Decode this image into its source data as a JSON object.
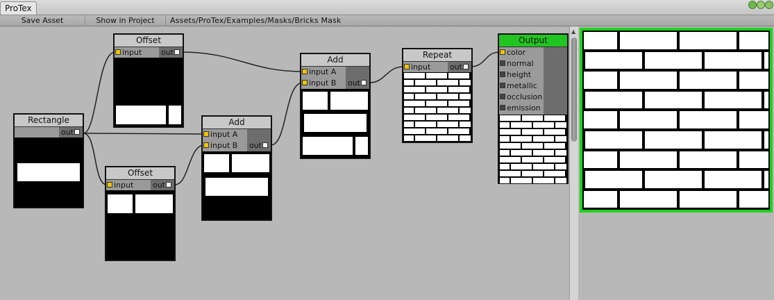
{
  "window": {
    "tab_title": "ProTex"
  },
  "toolbar": {
    "save_asset": "Save Asset",
    "show_in_project": "Show in Project",
    "asset_path": "Assets/ProTex/Examples/Masks/Bricks Mask"
  },
  "nodes": {
    "offset1": {
      "title": "Offset",
      "input": "input",
      "out": "out"
    },
    "offset2": {
      "title": "Offset",
      "input": "input",
      "out": "out"
    },
    "rectangle": {
      "title": "Rectangle",
      "out": "out"
    },
    "add1": {
      "title": "Add",
      "input_a": "input A",
      "input_b": "input B",
      "out": "out"
    },
    "add2": {
      "title": "Add",
      "input_a": "input A",
      "input_b": "input B",
      "out": "out"
    },
    "repeat": {
      "title": "Repeat",
      "input": "input",
      "out": "out"
    },
    "output": {
      "title": "Output",
      "inputs": [
        "color",
        "normal",
        "height",
        "metallic",
        "occlusion",
        "emission"
      ]
    }
  },
  "colors": {
    "output_header": "#21c521",
    "preview_border": "#1fd11f",
    "pin_connected": "#f0c400",
    "canvas_bg": "#b8b8b8"
  }
}
